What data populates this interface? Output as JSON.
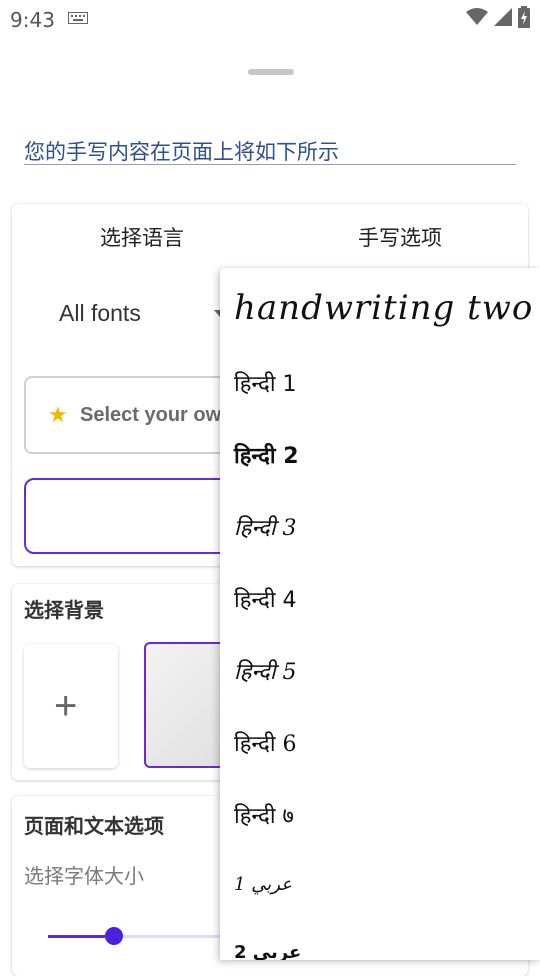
{
  "status_bar": {
    "time": "9:43"
  },
  "preview": {
    "text": "您的手写内容在页面上将如下所示"
  },
  "tabs": {
    "language": "选择语言",
    "options": "手写选项"
  },
  "font_selector": {
    "value": "All fonts"
  },
  "select_own_font": {
    "label": "Select your own"
  },
  "sections": {
    "background_title": "选择背景",
    "page_text_title": "页面和文本选项",
    "font_size_label": "选择字体大小"
  },
  "font_size_slider": {
    "value_fraction": 0.33
  },
  "font_options": [
    "handwriting two",
    "हिन्दी 1",
    "हिन्दी 2",
    "हिन्दी 3",
    "हिन्दी 4",
    "हिन्दी 5",
    "हिन्दी 6",
    "हिन्दी ७",
    "عربي 1",
    "عربي 2"
  ],
  "colors": {
    "accent": "#6a2ad6",
    "slider": "#4b22e0",
    "preview_text": "#2f4f8f"
  }
}
